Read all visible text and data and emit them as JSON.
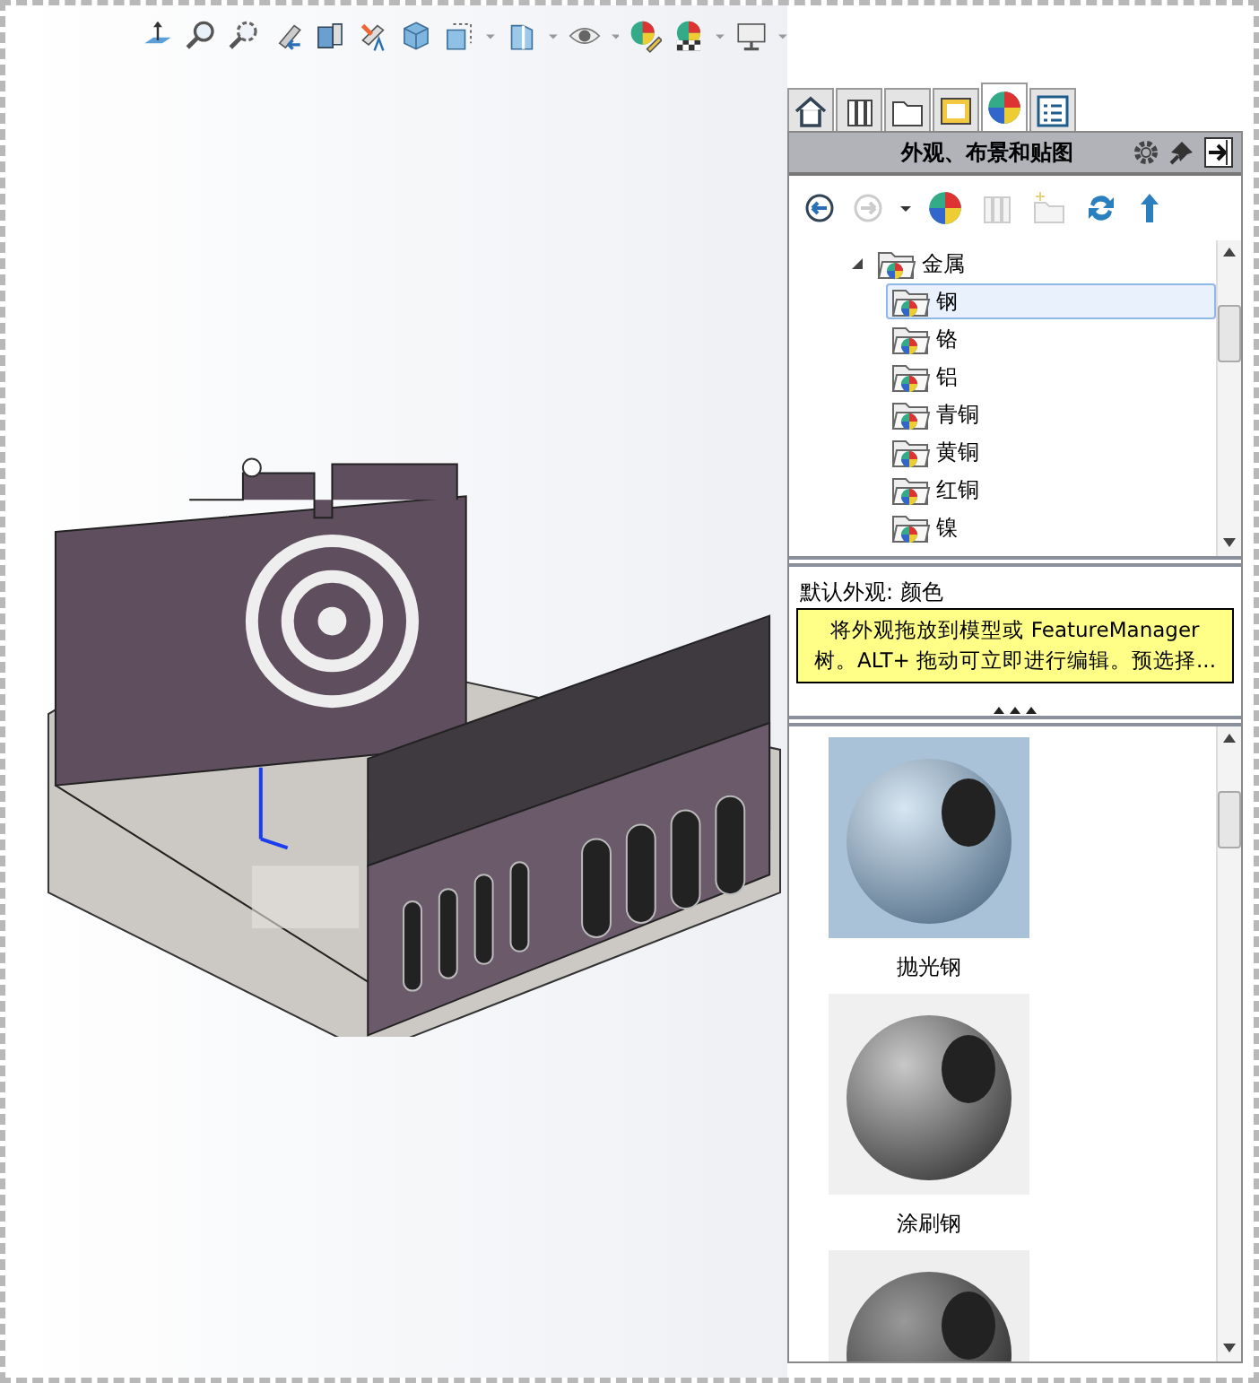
{
  "panel": {
    "tabs": [
      {
        "selected": false
      },
      {
        "selected": false
      },
      {
        "selected": false
      },
      {
        "selected": false
      },
      {
        "selected": true
      },
      {
        "selected": false
      }
    ],
    "title": "外观、布景和贴图",
    "tree": {
      "label": "金属",
      "expanded": true,
      "children": [
        {
          "label": "钢",
          "selected": true
        },
        {
          "label": "铬",
          "selected": false
        },
        {
          "label": "铝",
          "selected": false
        },
        {
          "label": "青铜",
          "selected": false
        },
        {
          "label": "黄铜",
          "selected": false
        },
        {
          "label": "红铜",
          "selected": false
        },
        {
          "label": "镍",
          "selected": false
        }
      ]
    },
    "default_appearance": "默认外观: 颜色",
    "tip": "将外观拖放到模型或 FeatureManager 树。ALT+ 拖动可立即进行编辑。预选择...",
    "swatches": [
      {
        "label": "抛光钢",
        "kind": "polished"
      },
      {
        "label": "涂刷钢",
        "kind": "brushed"
      }
    ]
  }
}
